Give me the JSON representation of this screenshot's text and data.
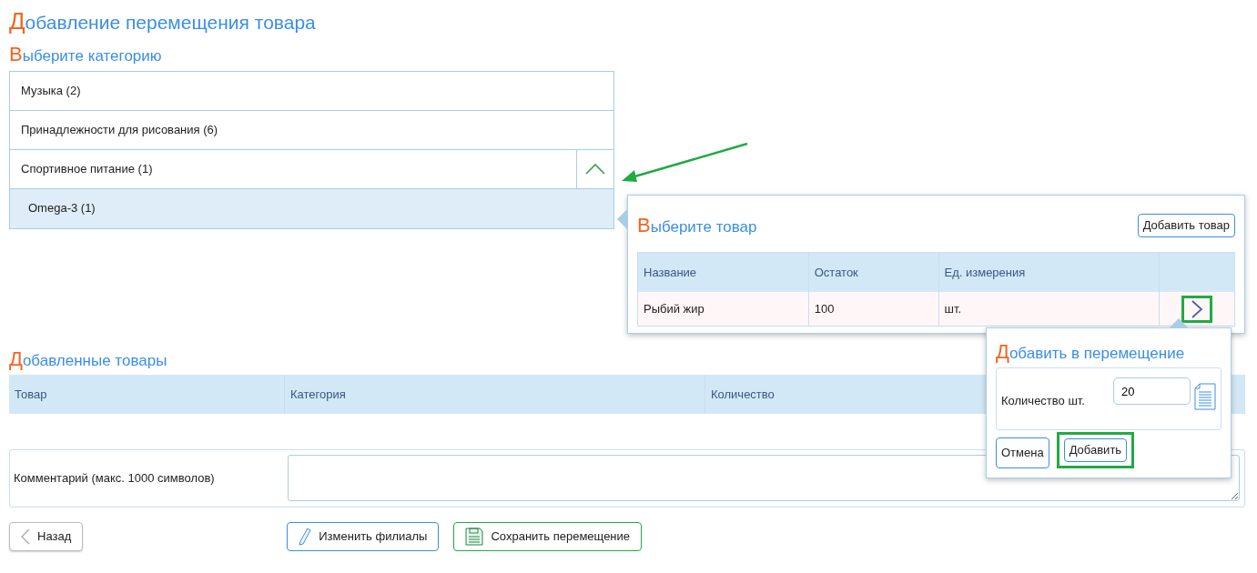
{
  "page_title": "Добавление перемещения товара",
  "category_section": {
    "title": "Выберите категорию",
    "categories": [
      {
        "label": "Музыка (2)",
        "expanded": false
      },
      {
        "label": "Принадлежности для рисования (6)",
        "expanded": false
      },
      {
        "label": "Спортивное питание (1)",
        "expanded": true,
        "children": [
          {
            "label": "Omega-3 (1)",
            "selected": true
          }
        ]
      }
    ]
  },
  "product_popup": {
    "title": "Выберите товар",
    "add_button": "Добавить товар",
    "columns": [
      "Название",
      "Остаток",
      "Ед. измерения"
    ],
    "rows": [
      {
        "cells": [
          "Рыбий жир",
          "100",
          "шт."
        ]
      }
    ]
  },
  "add_popup": {
    "title": "Добавить в перемещение",
    "quantity_label": "Количество шт.",
    "quantity_value": "20",
    "cancel_button": "Отмена",
    "confirm_button": "Добавить"
  },
  "added_section": {
    "title": "Добавленные товары",
    "columns": [
      "Товар",
      "Категория",
      "Количество"
    ]
  },
  "comment": {
    "label": "Комментарий (макс. 1000 символов)"
  },
  "actions": {
    "back": "Назад",
    "change_branches": "Изменить филиалы",
    "save": "Сохранить перемещение"
  }
}
